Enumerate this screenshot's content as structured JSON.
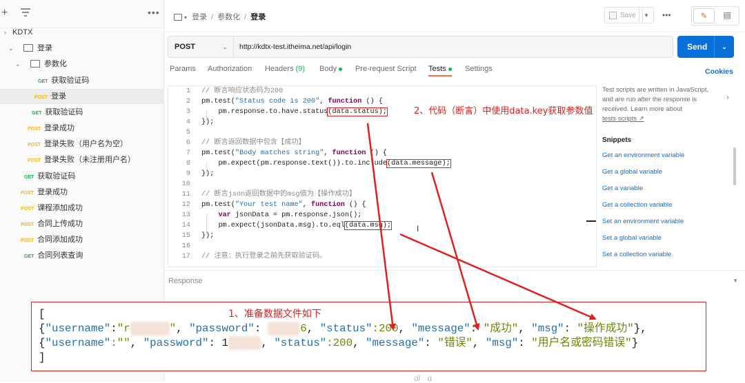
{
  "sidebar": {
    "plus": "+",
    "dots": "•••",
    "rows": [
      {
        "chev": "›",
        "label": "KDTX"
      },
      {
        "chev": "⌄",
        "label": "登录"
      },
      {
        "chev": "⌄",
        "label": "参数化"
      },
      {
        "method": "GET",
        "label": "获取验证码"
      },
      {
        "method": "POST",
        "label": "登录"
      },
      {
        "method": "GET",
        "label": "获取验证码"
      },
      {
        "method": "POST",
        "label": "登录成功"
      },
      {
        "method": "POST",
        "label": "登录失败（用户名为空）"
      },
      {
        "method": "POST",
        "label": "登录失败（未注册用户名）"
      },
      {
        "method": "GET",
        "label": "获取验证码"
      },
      {
        "method": "POST",
        "label": "登录成功"
      },
      {
        "method": "POST",
        "label": "课程添加成功"
      },
      {
        "method": "POST",
        "label": "合同上传成功"
      },
      {
        "method": "POST",
        "label": "合同添加成功"
      },
      {
        "method": "GET",
        "label": "合同列表查询"
      }
    ]
  },
  "header": {
    "breadcrumb": [
      "登录",
      "参数化",
      "登录"
    ],
    "save_label": "Save"
  },
  "request": {
    "method": "POST",
    "url": "http://kdtx-test.itheima.net/api/login",
    "send_label": "Send"
  },
  "tabs": {
    "params": "Params",
    "auth": "Authorization",
    "headers": "Headers",
    "headers_count": "(9)",
    "body": "Body",
    "prerequest": "Pre-request Script",
    "tests": "Tests",
    "settings": "Settings",
    "cookies": "Cookies"
  },
  "editor": {
    "line_numbers": [
      "1",
      "2",
      "3",
      "4",
      "5",
      "6",
      "7",
      "8",
      "9",
      "10",
      "11",
      "12",
      "13",
      "14",
      "15",
      "16",
      "17"
    ],
    "l1": "// 断言响应状态码为200",
    "l2_a": "pm.test(",
    "l2_s": "\"Status code is 200\"",
    "l2_b": ", ",
    "l2_kw": "function",
    "l2_c": " () {",
    "l3_a": "    pm.response.to.have.status",
    "l3_h": "(data.status);",
    "l4": "});",
    "l6": "// 断言返回数据中包含【成功】",
    "l7_a": "pm.test(",
    "l7_s": "\"Body matches string\"",
    "l7_b": ", ",
    "l7_kw": "function",
    "l7_c": " () {",
    "l8_a": "    pm.expect(pm.response.text()).to.include",
    "l8_h": "(data.message);",
    "l9": "});",
    "l11": "// 断言json返回数据中的msg值为【操作成功】",
    "l12_a": "pm.test(",
    "l12_s": "\"Your test name\"",
    "l12_b": ", ",
    "l12_kw": "function",
    "l12_c": " () {",
    "l13_kw": "    var",
    "l13_a": " jsonData = pm.response.json();",
    "l14_a": "    pm.expect(jsonData.msg).to.eql",
    "l14_h": "(data.msg);",
    "l15": "});",
    "l17": "// 注意：执行登录之前先获取验证码。"
  },
  "right_panel": {
    "desc": "Test scripts are written in JavaScript, and are run after the response is received. Learn more about",
    "link": "tests scripts ↗",
    "snippets_title": "Snippets",
    "snippets": [
      "Get an environment variable",
      "Get a global variable",
      "Get a variable",
      "Get a collection variable",
      "Set an environment variable",
      "Set a global variable",
      "Set a collection variable"
    ]
  },
  "response": {
    "label": "Response"
  },
  "data_file": {
    "open": "[",
    "r1_pre": "{",
    "r1_k1": "\"username\"",
    "r1_c1": ":",
    "r1_v1": "\"r",
    "r1_v1b": "\"",
    "r1_k2": "\"password\"",
    "r1_c2": ": ",
    "r1_v2": "6",
    "r1_k3": "\"status\"",
    "r1_v3": ":200",
    "r1_k4": "\"message\"",
    "r1_v4": "\"成功\"",
    "r1_k5": "\"msg\"",
    "r1_v5": "\"操作成功\"",
    "r1_end": "},",
    "r2_pre": "{",
    "r2_k1": "\"username\"",
    "r2_v1": ":\"\"",
    "r2_k2": "\"password\"",
    "r2_c2": ": 1",
    "r2_v2": "",
    "r2_k3": "\"status\"",
    "r2_v3": ":200",
    "r2_k4": "\"message\"",
    "r2_v4": "\"错误\"",
    "r2_k5": "\"msg\"",
    "r2_v5": "\"用户名或密码错误\"",
    "r2_end": "}",
    "close": "]"
  },
  "annotations": {
    "a1": "1、准备数据文件如下",
    "a2": "2、代码（断言）中使用data.key获取参数值"
  },
  "colors": {
    "accent": "#ff6c37",
    "send": "#0b6fd9",
    "annotation": "#e02020"
  }
}
